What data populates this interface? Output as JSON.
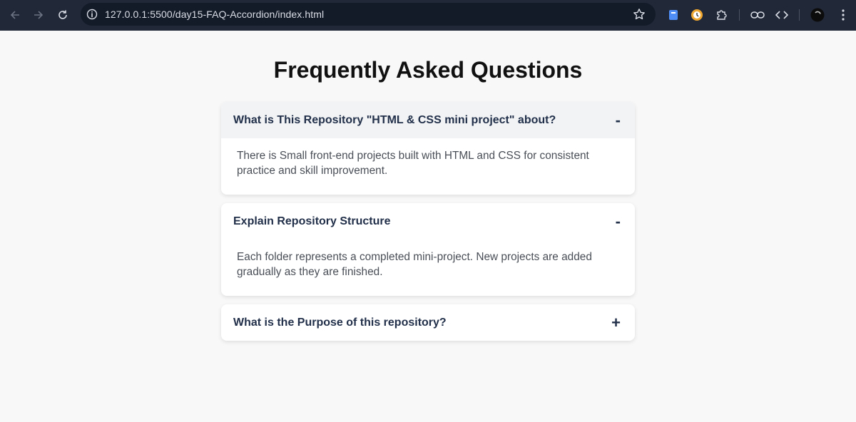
{
  "browser": {
    "url": "127.0.0.1:5500/day15-FAQ-Accordion/index.html"
  },
  "page": {
    "title": "Frequently Asked Questions"
  },
  "faqs": [
    {
      "question": "What is This Repository \"HTML & CSS mini project\" about?",
      "toggle": "-",
      "answer": "There is Small front-end projects built with HTML and CSS for consistent practice and skill improvement.",
      "expanded": true
    },
    {
      "question": "Explain Repository Structure",
      "toggle": "-",
      "answer": "Each folder represents a completed mini-project. New projects are added gradually as they are finished.",
      "expanded": true
    },
    {
      "question": "What is the Purpose of this repository?",
      "toggle": "+",
      "expanded": false
    }
  ],
  "colors": {
    "chrome_bg": "#212838",
    "page_bg": "#f8f8f8",
    "question_text": "#22304a",
    "answer_text": "#4a4f57"
  },
  "icons": [
    "back-arrow-icon",
    "forward-arrow-icon",
    "reload-icon",
    "info-icon",
    "star-icon",
    "document-extension-icon",
    "clock-extension-icon",
    "puzzle-icon",
    "link-icon",
    "code-icon",
    "profile-avatar-icon"
  ]
}
